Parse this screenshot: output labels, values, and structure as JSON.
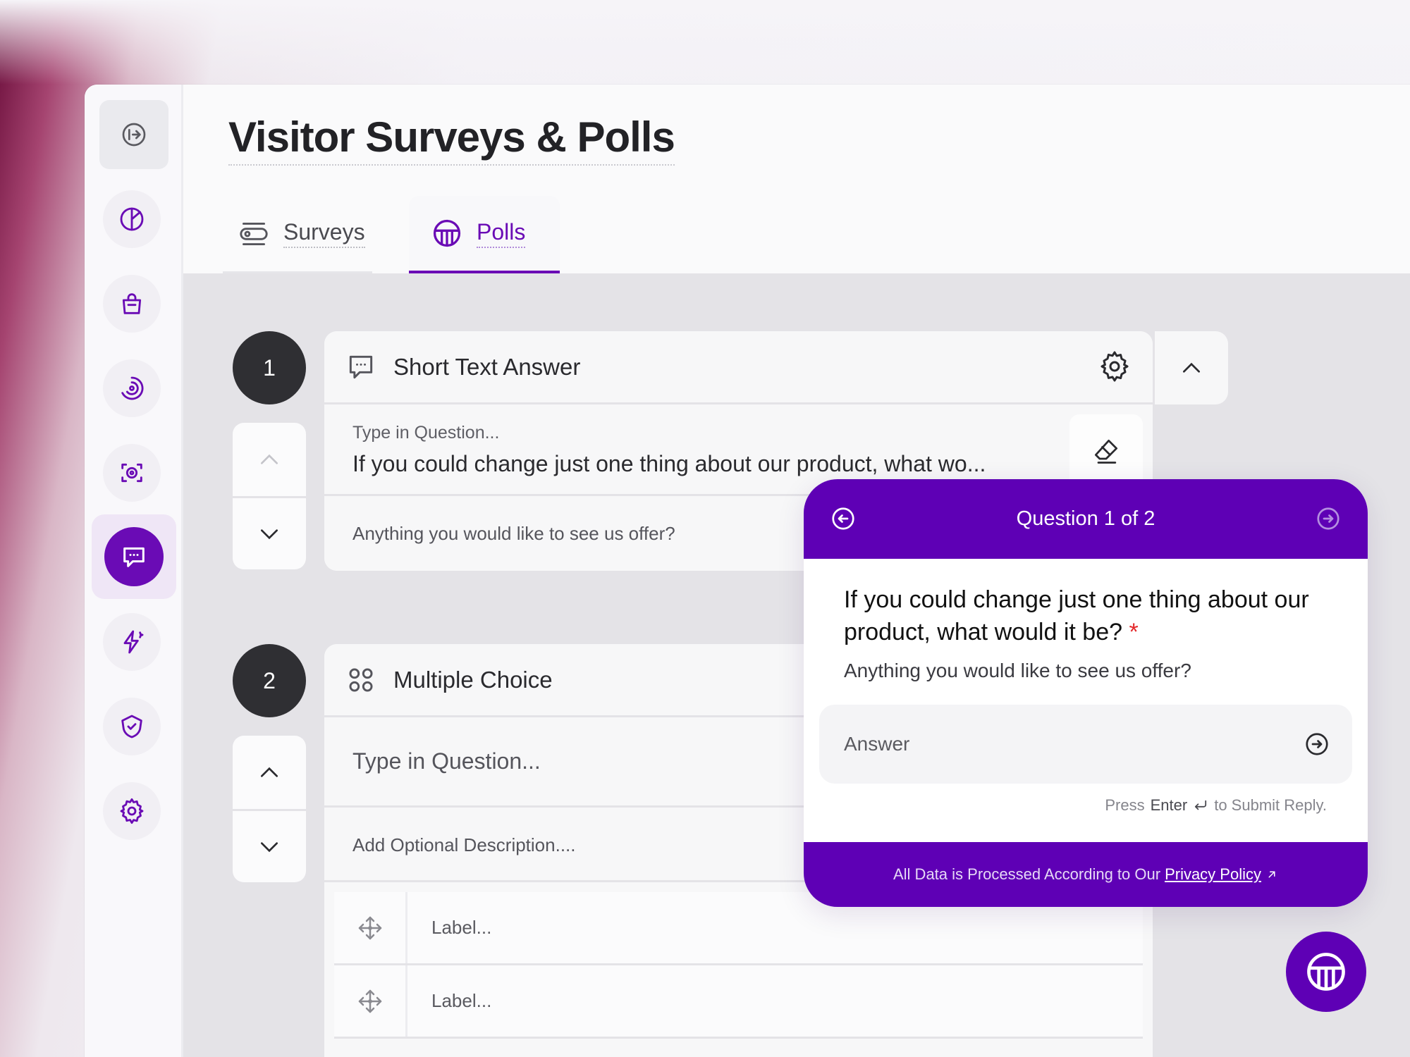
{
  "page": {
    "title": "Visitor Surveys & Polls"
  },
  "tabs": [
    {
      "label": "Surveys",
      "icon": "toggle-icon",
      "active": false
    },
    {
      "label": "Polls",
      "icon": "poll-icon",
      "active": true
    }
  ],
  "sidebar": {
    "items": [
      {
        "icon": "logout-icon"
      },
      {
        "icon": "pie-chart-icon"
      },
      {
        "icon": "shopping-bag-icon"
      },
      {
        "icon": "radar-icon"
      },
      {
        "icon": "focus-eye-icon"
      },
      {
        "icon": "chat-bubble-icon",
        "active": true
      },
      {
        "icon": "sparkle-bolt-icon"
      },
      {
        "icon": "shield-check-icon"
      },
      {
        "icon": "gear-icon"
      }
    ]
  },
  "questions": [
    {
      "number": "1",
      "type_label": "Short Text Answer",
      "question_placeholder": "Type in Question...",
      "question_text": "If you could change just one thing about our product, what wo...",
      "description": "Anything you would like to see us offer?"
    },
    {
      "number": "2",
      "type_label": "Multiple Choice",
      "question_placeholder": "Type in Question...",
      "description_placeholder": "Add Optional Description....",
      "options": [
        {
          "label": "Label..."
        },
        {
          "label": "Label..."
        }
      ]
    }
  ],
  "preview": {
    "progress": "Question 1 of 2",
    "question": "If you could change just one thing about our product, what would it be?",
    "required_mark": "*",
    "description": "Anything you would like to see us offer?",
    "answer_placeholder": "Answer",
    "hint_pre": "Press",
    "hint_key": "Enter",
    "hint_post": "to Submit Reply.",
    "footer_text": "All Data is Processed According to Our",
    "footer_link": "Privacy Policy"
  },
  "colors": {
    "accent": "#5e00b5",
    "active_icon": "#6a0bb5",
    "required": "#e3282b"
  }
}
